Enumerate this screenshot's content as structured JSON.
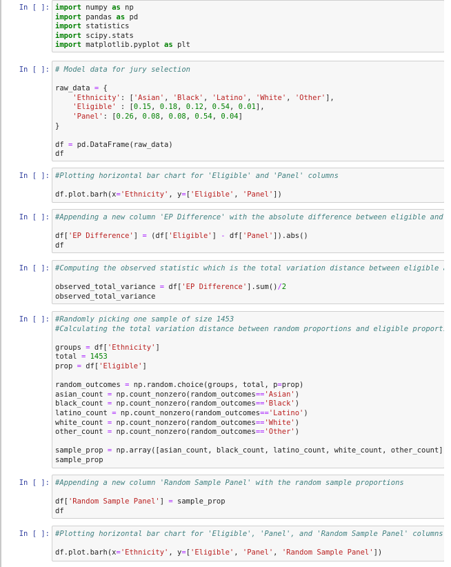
{
  "prompt_label": "In [ ]:",
  "cells": [
    {
      "lines": [
        [
          {
            "t": "import",
            "c": "kw"
          },
          {
            "t": " numpy "
          },
          {
            "t": "as",
            "c": "kw"
          },
          {
            "t": " np"
          }
        ],
        [
          {
            "t": "import",
            "c": "kw"
          },
          {
            "t": " pandas "
          },
          {
            "t": "as",
            "c": "kw"
          },
          {
            "t": " pd"
          }
        ],
        [
          {
            "t": "import",
            "c": "kw"
          },
          {
            "t": " statistics"
          }
        ],
        [
          {
            "t": "import",
            "c": "kw"
          },
          {
            "t": " scipy.stats"
          }
        ],
        [
          {
            "t": "import",
            "c": "kw"
          },
          {
            "t": " matplotlib.pyplot "
          },
          {
            "t": "as",
            "c": "kw"
          },
          {
            "t": " plt"
          }
        ]
      ]
    },
    {
      "lines": [
        [
          {
            "t": "# Model data for jury selection",
            "c": "cm"
          }
        ],
        [],
        [
          {
            "t": "raw_data "
          },
          {
            "t": "=",
            "c": "op"
          },
          {
            "t": " {"
          }
        ],
        [
          {
            "t": "    "
          },
          {
            "t": "'Ethnicity'",
            "c": "st"
          },
          {
            "t": ": ["
          },
          {
            "t": "'Asian'",
            "c": "st"
          },
          {
            "t": ", "
          },
          {
            "t": "'Black'",
            "c": "st"
          },
          {
            "t": ", "
          },
          {
            "t": "'Latino'",
            "c": "st"
          },
          {
            "t": ", "
          },
          {
            "t": "'White'",
            "c": "st"
          },
          {
            "t": ", "
          },
          {
            "t": "'Other'",
            "c": "st"
          },
          {
            "t": "],"
          }
        ],
        [
          {
            "t": "    "
          },
          {
            "t": "'Eligible'",
            "c": "st"
          },
          {
            "t": " : ["
          },
          {
            "t": "0.15",
            "c": "nu"
          },
          {
            "t": ", "
          },
          {
            "t": "0.18",
            "c": "nu"
          },
          {
            "t": ", "
          },
          {
            "t": "0.12",
            "c": "nu"
          },
          {
            "t": ", "
          },
          {
            "t": "0.54",
            "c": "nu"
          },
          {
            "t": ", "
          },
          {
            "t": "0.01",
            "c": "nu"
          },
          {
            "t": "],"
          }
        ],
        [
          {
            "t": "    "
          },
          {
            "t": "'Panel'",
            "c": "st"
          },
          {
            "t": ": ["
          },
          {
            "t": "0.26",
            "c": "nu"
          },
          {
            "t": ", "
          },
          {
            "t": "0.08",
            "c": "nu"
          },
          {
            "t": ", "
          },
          {
            "t": "0.08",
            "c": "nu"
          },
          {
            "t": ", "
          },
          {
            "t": "0.54",
            "c": "nu"
          },
          {
            "t": ", "
          },
          {
            "t": "0.04",
            "c": "nu"
          },
          {
            "t": "]"
          }
        ],
        [
          {
            "t": "}"
          }
        ],
        [],
        [
          {
            "t": "df "
          },
          {
            "t": "=",
            "c": "op"
          },
          {
            "t": " pd.DataFrame(raw_data)"
          }
        ],
        [
          {
            "t": "df"
          }
        ]
      ]
    },
    {
      "lines": [
        [
          {
            "t": "#Plotting horizontal bar chart for 'Eligible' and 'Panel' columns",
            "c": "cm"
          }
        ],
        [],
        [
          {
            "t": "df.plot.barh(x"
          },
          {
            "t": "=",
            "c": "op"
          },
          {
            "t": "'Ethnicity'",
            "c": "st"
          },
          {
            "t": ", y"
          },
          {
            "t": "=",
            "c": "op"
          },
          {
            "t": "["
          },
          {
            "t": "'Eligible'",
            "c": "st"
          },
          {
            "t": ", "
          },
          {
            "t": "'Panel'",
            "c": "st"
          },
          {
            "t": "])"
          }
        ]
      ]
    },
    {
      "lines": [
        [
          {
            "t": "#Appending a new column 'EP Difference' with the absolute difference between eligible and p",
            "c": "cm"
          }
        ],
        [],
        [
          {
            "t": "df["
          },
          {
            "t": "'EP Difference'",
            "c": "st"
          },
          {
            "t": "] "
          },
          {
            "t": "=",
            "c": "op"
          },
          {
            "t": " (df["
          },
          {
            "t": "'Eligible'",
            "c": "st"
          },
          {
            "t": "] "
          },
          {
            "t": "-",
            "c": "op"
          },
          {
            "t": " df["
          },
          {
            "t": "'Panel'",
            "c": "st"
          },
          {
            "t": "]).abs()"
          }
        ],
        [
          {
            "t": "df"
          }
        ]
      ]
    },
    {
      "lines": [
        [
          {
            "t": "#Computing the observed statistic which is the total variation distance between eligible an",
            "c": "cm"
          }
        ],
        [],
        [
          {
            "t": "observed_total_variance "
          },
          {
            "t": "=",
            "c": "op"
          },
          {
            "t": " df["
          },
          {
            "t": "'EP Difference'",
            "c": "st"
          },
          {
            "t": "].sum()"
          },
          {
            "t": "/",
            "c": "op"
          },
          {
            "t": "2",
            "c": "nu"
          }
        ],
        [
          {
            "t": "observed_total_variance"
          }
        ]
      ]
    },
    {
      "lines": [
        [
          {
            "t": "#Randomly picking one sample of size 1453",
            "c": "cm"
          }
        ],
        [
          {
            "t": "#Calculating the total variation distance between random proportions and eligible proportio",
            "c": "cm"
          }
        ],
        [],
        [
          {
            "t": "groups "
          },
          {
            "t": "=",
            "c": "op"
          },
          {
            "t": " df["
          },
          {
            "t": "'Ethnicity'",
            "c": "st"
          },
          {
            "t": "]"
          }
        ],
        [
          {
            "t": "total "
          },
          {
            "t": "=",
            "c": "op"
          },
          {
            "t": " "
          },
          {
            "t": "1453",
            "c": "nu"
          }
        ],
        [
          {
            "t": "prop "
          },
          {
            "t": "=",
            "c": "op"
          },
          {
            "t": " df["
          },
          {
            "t": "'Eligible'",
            "c": "st"
          },
          {
            "t": "]"
          }
        ],
        [],
        [
          {
            "t": "random_outcomes "
          },
          {
            "t": "=",
            "c": "op"
          },
          {
            "t": " np.random.choice(groups, total, p"
          },
          {
            "t": "=",
            "c": "op"
          },
          {
            "t": "prop)"
          }
        ],
        [
          {
            "t": "asian_count "
          },
          {
            "t": "=",
            "c": "op"
          },
          {
            "t": " np.count_nonzero(random_outcomes"
          },
          {
            "t": "==",
            "c": "op"
          },
          {
            "t": "'Asian'",
            "c": "st"
          },
          {
            "t": ")"
          }
        ],
        [
          {
            "t": "black_count "
          },
          {
            "t": "=",
            "c": "op"
          },
          {
            "t": " np.count_nonzero(random_outcomes"
          },
          {
            "t": "==",
            "c": "op"
          },
          {
            "t": "'Black'",
            "c": "st"
          },
          {
            "t": ")"
          }
        ],
        [
          {
            "t": "latino_count "
          },
          {
            "t": "=",
            "c": "op"
          },
          {
            "t": " np.count_nonzero(random_outcomes"
          },
          {
            "t": "==",
            "c": "op"
          },
          {
            "t": "'Latino'",
            "c": "st"
          },
          {
            "t": ")"
          }
        ],
        [
          {
            "t": "white_count "
          },
          {
            "t": "=",
            "c": "op"
          },
          {
            "t": " np.count_nonzero(random_outcomes"
          },
          {
            "t": "==",
            "c": "op"
          },
          {
            "t": "'White'",
            "c": "st"
          },
          {
            "t": ")"
          }
        ],
        [
          {
            "t": "other_count "
          },
          {
            "t": "=",
            "c": "op"
          },
          {
            "t": " np.count_nonzero(random_outcomes"
          },
          {
            "t": "==",
            "c": "op"
          },
          {
            "t": "'Other'",
            "c": "st"
          },
          {
            "t": ")"
          }
        ],
        [],
        [
          {
            "t": "sample_prop "
          },
          {
            "t": "=",
            "c": "op"
          },
          {
            "t": " np.array([asian_count, black_count, latino_count, white_count, other_count])/"
          }
        ],
        [
          {
            "t": "sample_prop"
          }
        ]
      ]
    },
    {
      "lines": [
        [
          {
            "t": "#Appending a new column 'Random Sample Panel' with the random sample proportions",
            "c": "cm"
          }
        ],
        [],
        [
          {
            "t": "df["
          },
          {
            "t": "'Random Sample Panel'",
            "c": "st"
          },
          {
            "t": "] "
          },
          {
            "t": "=",
            "c": "op"
          },
          {
            "t": " sample_prop"
          }
        ],
        [
          {
            "t": "df"
          }
        ]
      ]
    },
    {
      "lines": [
        [
          {
            "t": "#Plotting horizontal bar chart for 'Eligible', 'Panel', and 'Random Sample Panel' columns",
            "c": "cm"
          }
        ],
        [],
        [
          {
            "t": "df.plot.barh(x"
          },
          {
            "t": "=",
            "c": "op"
          },
          {
            "t": "'Ethnicity'",
            "c": "st"
          },
          {
            "t": ", y"
          },
          {
            "t": "=",
            "c": "op"
          },
          {
            "t": "["
          },
          {
            "t": "'Eligible'",
            "c": "st"
          },
          {
            "t": ", "
          },
          {
            "t": "'Panel'",
            "c": "st"
          },
          {
            "t": ", "
          },
          {
            "t": "'Random Sample Panel'",
            "c": "st"
          },
          {
            "t": "])"
          }
        ]
      ]
    }
  ]
}
